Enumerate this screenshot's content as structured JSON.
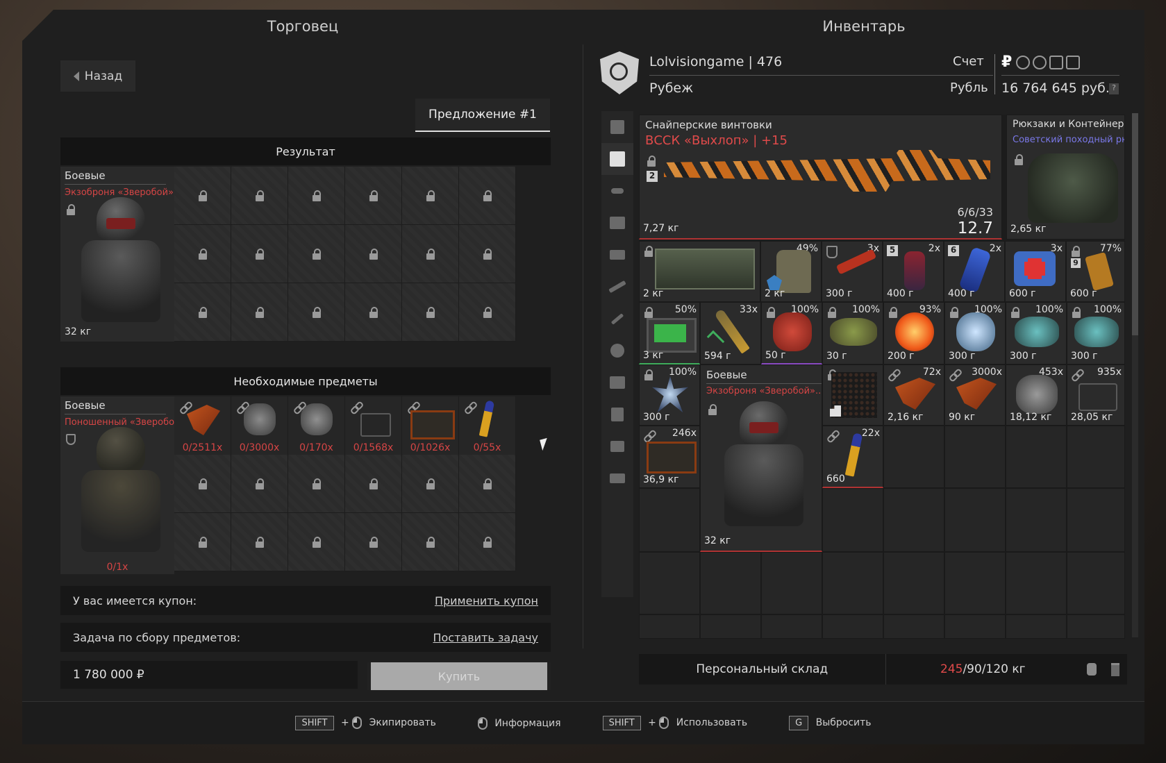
{
  "merchant": {
    "title": "Торговец",
    "back_label": "Назад",
    "offer_tab": "Предложение #1",
    "result": {
      "header": "Результат",
      "item": {
        "category": "Боевые",
        "name": "Экзоброня «Зверобой»",
        "weight": "32 кг"
      }
    },
    "required": {
      "header": "Необходимые предметы",
      "item": {
        "category": "Боевые",
        "name": "Поношенный «Зверобо..",
        "count": "0/1x"
      },
      "counts": [
        "0/2511x",
        "0/3000x",
        "0/170x",
        "0/1568x",
        "0/1026x",
        "0/55x"
      ]
    },
    "coupon": {
      "label": "У вас имеется купон:",
      "action": "Применить купон"
    },
    "task": {
      "label": "Задача по сбору предметов:",
      "action": "Поставить задачу"
    },
    "price": "1 780 000 ₽",
    "buy_label": "Купить"
  },
  "inventory": {
    "title": "Инвентарь",
    "user": "Lolvisiongame | 476",
    "group": "Рубеж",
    "account_label": "Счет",
    "currency_label": "Рубль",
    "balance": "16 764 645 руб.",
    "help": "?",
    "currency_symbol": "₽",
    "weapon": {
      "category": "Снайперские винтовки",
      "name": "ВССК «Выхлоп» | +15",
      "weight": "7,27 кг",
      "ammo": "6/6/33",
      "caliber": "12.7",
      "slot": "2"
    },
    "backpack": {
      "category": "Рюкзаки и Контейнеры",
      "name": "Советский походный рю..",
      "weight": "2,65 кг"
    },
    "row1": [
      {
        "wt": "2 кг",
        "qty": ""
      },
      {
        "wt": "2 кг",
        "qty": "49%"
      },
      {
        "wt": "300 г",
        "qty": "3x"
      },
      {
        "wt": "400 г",
        "qty": "2x",
        "badge": "5"
      },
      {
        "wt": "400 г",
        "qty": "2x",
        "badge": "6"
      },
      {
        "wt": "600 г",
        "qty": "3x"
      },
      {
        "wt": "600 г",
        "qty": "77%",
        "badge": "9"
      }
    ],
    "row2": [
      {
        "wt": "3 кг",
        "qty": "50%"
      },
      {
        "wt": "594 г",
        "qty": "33x"
      },
      {
        "wt": "50 г",
        "qty": "100%"
      },
      {
        "wt": "30 г",
        "qty": "100%"
      },
      {
        "wt": "200 г",
        "qty": "93%"
      },
      {
        "wt": "300 г",
        "qty": "100%"
      },
      {
        "wt": "300 г",
        "qty": "100%"
      },
      {
        "wt": "300 г",
        "qty": "100%"
      }
    ],
    "row3": [
      {
        "wt": "300 г",
        "qty": "100%"
      },
      {
        "wt": "2,16 кг",
        "qty": "72x"
      },
      {
        "wt": "90 кг",
        "qty": "3000x"
      },
      {
        "wt": "18,12 кг",
        "qty": "453x"
      },
      {
        "wt": "28,05 кг",
        "qty": "935x"
      }
    ],
    "row4": [
      {
        "wt": "36,9 кг",
        "qty": "246x"
      },
      {
        "wt": "660",
        "qty": "22x"
      }
    ],
    "armor": {
      "category": "Боевые",
      "name": "Экзоброня «Зверобой»..",
      "weight": "32 кг"
    },
    "storage_label": "Персональный склад",
    "weight_current": "245",
    "weight_rest": "/90/120 кг"
  },
  "footer": {
    "shift": "SHIFT",
    "plus": "+",
    "equip": "Экипировать",
    "info": "Информация",
    "use": "Использовать",
    "g_key": "G",
    "drop": "Выбросить"
  }
}
